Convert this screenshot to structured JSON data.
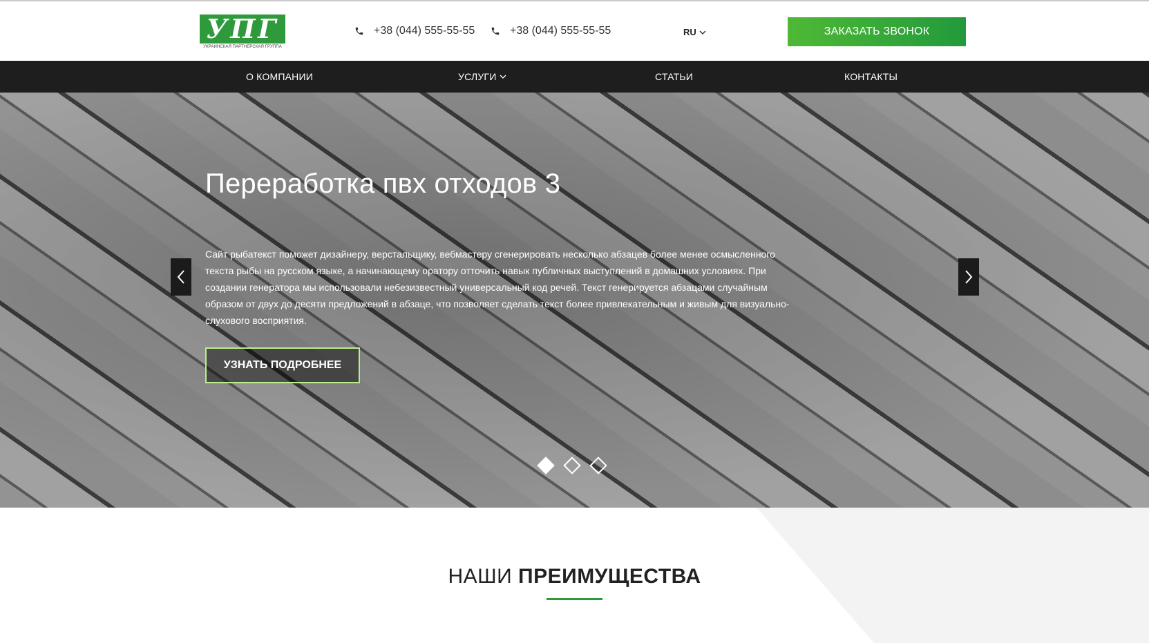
{
  "header": {
    "logo_text": "УПГ",
    "logo_subtitle": "УКРАИНСКАЯ ПАРТНЕРСКАЯ ГРУППА",
    "phones": [
      "+38 (044) 555-55-55",
      "+38 (044) 555-55-55"
    ],
    "language": "RU",
    "callback_button": "ЗАКАЗАТЬ ЗВОНОК"
  },
  "nav": {
    "items": [
      "О КОМПАНИИ",
      "УСЛУГИ",
      "СТАТЬИ",
      "КОНТАКТЫ"
    ]
  },
  "hero": {
    "title": "Переработка пвх отходов 3",
    "text": "Сайт рыбатекст поможет дизайнеру, верстальщику, вебмастеру сгенерировать несколько абзацев более менее осмысленного текста рыбы на русском языке, а начинающему оратору отточить навык публичных выступлений в домашних условиях. При создании генератора мы использовали небезизвестный универсальный код речей. Текст генерируется абзацами случайным образом от двух до десяти предложений в абзаце, что позволяет сделать текст более привлекательным и живым для визуально-слухового восприятия.",
    "button": "УЗНАТЬ ПОДРОБНЕЕ",
    "slides_total": 3,
    "active_slide": 1
  },
  "advantages": {
    "title_light": "НАШИ",
    "title_bold": "ПРЕИМУЩЕСТВА"
  },
  "colors": {
    "brand_green": "#2f9a3c",
    "nav_background": "#1e1e1e",
    "button_gradient_start": "#4fb936",
    "button_border": "#b8f08a"
  },
  "icons": [
    "phone-icon",
    "chevron-down-icon",
    "chevron-left-icon",
    "chevron-right-icon"
  ]
}
